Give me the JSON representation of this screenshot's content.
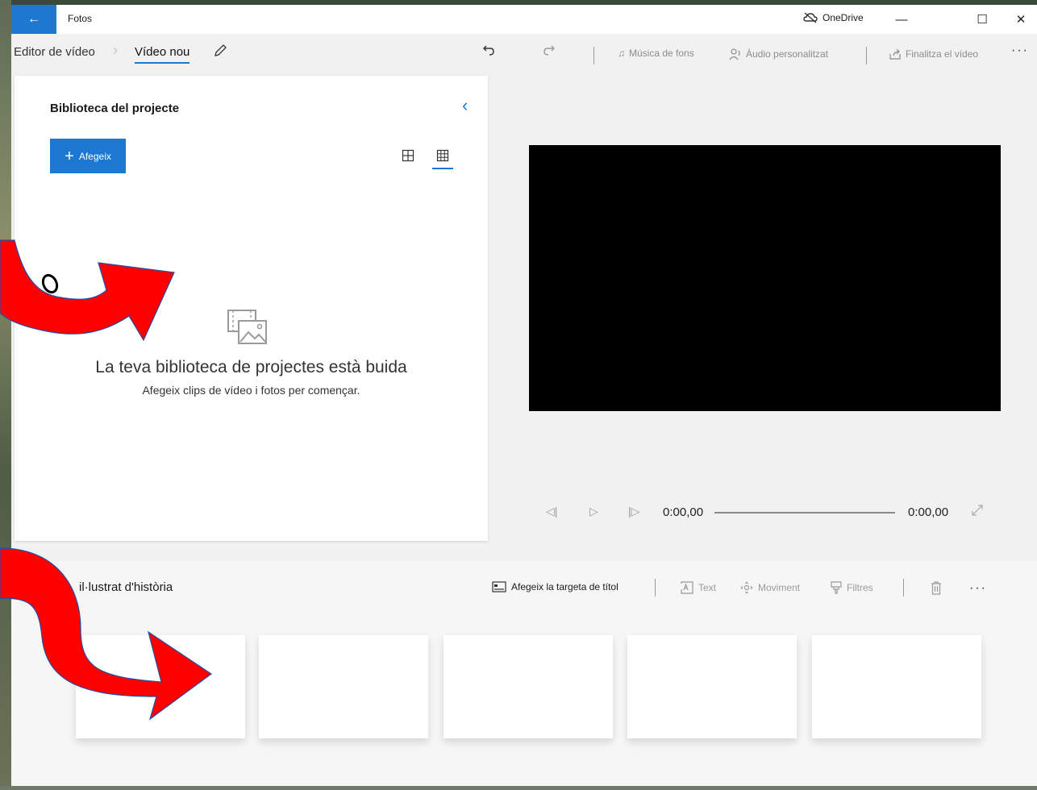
{
  "app": {
    "title": "Fotos",
    "onedrive_label": "OneDrive"
  },
  "breadcrumb": {
    "root": "Editor de vídeo",
    "current": "Vídeo nou"
  },
  "toolbar": {
    "background_music": "Música de fons",
    "custom_audio": "Àudio personalitzat",
    "finish_video": "Finalitza el vídeo",
    "more": "···"
  },
  "library": {
    "title": "Biblioteca del projecte",
    "add_label": "Afegeix",
    "empty_title": "La teva biblioteca de projectes està buida",
    "empty_subtitle": "Afegeix clips de vídeo i fotos per començar."
  },
  "player": {
    "current_time": "0:00,00",
    "total_time": "0:00,00"
  },
  "storyboard": {
    "title": "il·lustrat d'història",
    "add_title_card": "Afegeix la targeta de títol",
    "text_label": "Text",
    "motion_label": "Moviment",
    "filters_label": "Filtres",
    "more": "···",
    "card_count": 5
  },
  "annotation": {
    "glyph": "o"
  },
  "colors": {
    "accent": "#1c78d0",
    "arrow": "#ff0000",
    "preview": "#000000"
  },
  "icons": [
    "back-arrow-icon",
    "onedrive-cloud-icon",
    "minimize-icon",
    "maximize-icon",
    "close-icon",
    "pencil-icon",
    "undo-icon",
    "redo-icon",
    "music-note-icon",
    "audio-person-icon",
    "share-icon",
    "chevron-left-icon",
    "plus-icon",
    "grid-large-icon",
    "grid-small-icon",
    "film-photo-icon",
    "step-back-icon",
    "play-icon",
    "step-forward-icon",
    "expand-icon",
    "title-card-icon",
    "text-box-icon",
    "motion-icon",
    "filter-icon",
    "trash-icon"
  ]
}
